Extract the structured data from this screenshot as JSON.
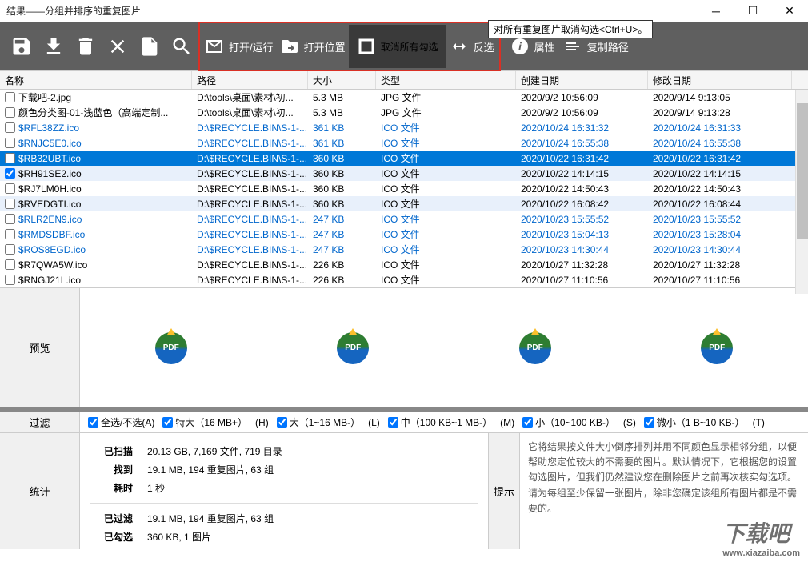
{
  "window": {
    "title": "结果——分组并排序的重复图片"
  },
  "tooltip": "对所有重复图片取消勾选<Ctrl+U>。",
  "toolbar": {
    "open_run": "打开/运行",
    "open_location": "打开位置",
    "deselect_all": "取消所有勾选",
    "invert": "反选",
    "properties": "属性",
    "copy_path": "复制路径"
  },
  "columns": {
    "name": "名称",
    "path": "路径",
    "size": "大小",
    "type": "类型",
    "created": "创建日期",
    "modified": "修改日期"
  },
  "rows": [
    {
      "name": "下载吧-2.jpg",
      "path": "D:\\tools\\桌面\\素材\\初...",
      "size": "5.3 MB",
      "type": "JPG 文件",
      "created": "2020/9/2 10:56:09",
      "modified": "2020/9/14 9:13:05",
      "blue": false,
      "checked": false
    },
    {
      "name": "颜色分类图-01-浅蓝色（高端定制...",
      "path": "D:\\tools\\桌面\\素材\\初...",
      "size": "5.3 MB",
      "type": "JPG 文件",
      "created": "2020/9/2 10:56:09",
      "modified": "2020/9/14 9:13:28",
      "blue": false,
      "checked": false
    },
    {
      "name": "$RFL38ZZ.ico",
      "path": "D:\\$RECYCLE.BIN\\S-1-...",
      "size": "361 KB",
      "type": "ICO 文件",
      "created": "2020/10/24 16:31:32",
      "modified": "2020/10/24 16:31:33",
      "blue": true,
      "checked": false
    },
    {
      "name": "$RNJC5E0.ico",
      "path": "D:\\$RECYCLE.BIN\\S-1-...",
      "size": "361 KB",
      "type": "ICO 文件",
      "created": "2020/10/24 16:55:38",
      "modified": "2020/10/24 16:55:38",
      "blue": true,
      "checked": false
    },
    {
      "name": "$RB32UBT.ico",
      "path": "D:\\$RECYCLE.BIN\\S-1-...",
      "size": "360 KB",
      "type": "ICO 文件",
      "created": "2020/10/22 16:31:42",
      "modified": "2020/10/22 16:31:42",
      "blue": false,
      "selected": true,
      "checked": false
    },
    {
      "name": "$RH91SE2.ico",
      "path": "D:\\$RECYCLE.BIN\\S-1-...",
      "size": "360 KB",
      "type": "ICO 文件",
      "created": "2020/10/22 14:14:15",
      "modified": "2020/10/22 14:14:15",
      "blue": false,
      "checked": true,
      "alt": true
    },
    {
      "name": "$RJ7LM0H.ico",
      "path": "D:\\$RECYCLE.BIN\\S-1-...",
      "size": "360 KB",
      "type": "ICO 文件",
      "created": "2020/10/22 14:50:43",
      "modified": "2020/10/22 14:50:43",
      "blue": false,
      "checked": false
    },
    {
      "name": "$RVEDGTI.ico",
      "path": "D:\\$RECYCLE.BIN\\S-1-...",
      "size": "360 KB",
      "type": "ICO 文件",
      "created": "2020/10/22 16:08:42",
      "modified": "2020/10/22 16:08:44",
      "blue": false,
      "checked": false,
      "alt": true
    },
    {
      "name": "$RLR2EN9.ico",
      "path": "D:\\$RECYCLE.BIN\\S-1-...",
      "size": "247 KB",
      "type": "ICO 文件",
      "created": "2020/10/23 15:55:52",
      "modified": "2020/10/23 15:55:52",
      "blue": true,
      "checked": false
    },
    {
      "name": "$RMDSDBF.ico",
      "path": "D:\\$RECYCLE.BIN\\S-1-...",
      "size": "247 KB",
      "type": "ICO 文件",
      "created": "2020/10/23 15:04:13",
      "modified": "2020/10/23 15:28:04",
      "blue": true,
      "checked": false
    },
    {
      "name": "$ROS8EGD.ico",
      "path": "D:\\$RECYCLE.BIN\\S-1-...",
      "size": "247 KB",
      "type": "ICO 文件",
      "created": "2020/10/23 14:30:44",
      "modified": "2020/10/23 14:30:44",
      "blue": true,
      "checked": false
    },
    {
      "name": "$R7QWA5W.ico",
      "path": "D:\\$RECYCLE.BIN\\S-1-...",
      "size": "226 KB",
      "type": "ICO 文件",
      "created": "2020/10/27 11:32:28",
      "modified": "2020/10/27 11:32:28",
      "blue": false,
      "checked": false
    },
    {
      "name": "$RNGJ21L.ico",
      "path": "D:\\$RECYCLE.BIN\\S-1-...",
      "size": "226 KB",
      "type": "ICO 文件",
      "created": "2020/10/27 11:10:56",
      "modified": "2020/10/27 11:10:56",
      "blue": false,
      "checked": false
    }
  ],
  "preview": {
    "label": "预览",
    "icon_text": "PDF"
  },
  "filter": {
    "label": "过滤",
    "select_all": "全选/不选(A)",
    "xl": "特大（16 MB+）",
    "h": "(H)",
    "l_label": "大（1~16 MB-）",
    "l": "(L)",
    "m_label": "中（100 KB~1 MB-）",
    "m": "(M)",
    "s_label": "小（10~100 KB-）",
    "s": "(S)",
    "t_label": "微小（1 B~10 KB-）",
    "t": "(T)"
  },
  "stats": {
    "label": "统计",
    "scanned_k": "已扫描",
    "scanned_v": "20.13 GB, 7,169 文件, 719 目录",
    "found_k": "找到",
    "found_v": "19.1 MB, 194 重复图片, 63 组",
    "time_k": "耗时",
    "time_v": "1 秒",
    "filtered_k": "已过滤",
    "filtered_v": "19.1 MB, 194 重复图片, 63 组",
    "checked_k": "已勾选",
    "checked_v": "360 KB, 1 图片"
  },
  "tips": {
    "label": "提示",
    "text": "它将结果按文件大小倒序排列并用不同颜色显示相邻分组，以便帮助您定位较大的不需要的图片。默认情况下，它根据您的设置勾选图片，但我们仍然建议您在删除图片之前再次核实勾选项。请为每组至少保留一张图片，除非您确定该组所有图片都是不需要的。"
  },
  "watermark": {
    "main": "下载吧",
    "sub": "www.xiazaiba.com"
  }
}
